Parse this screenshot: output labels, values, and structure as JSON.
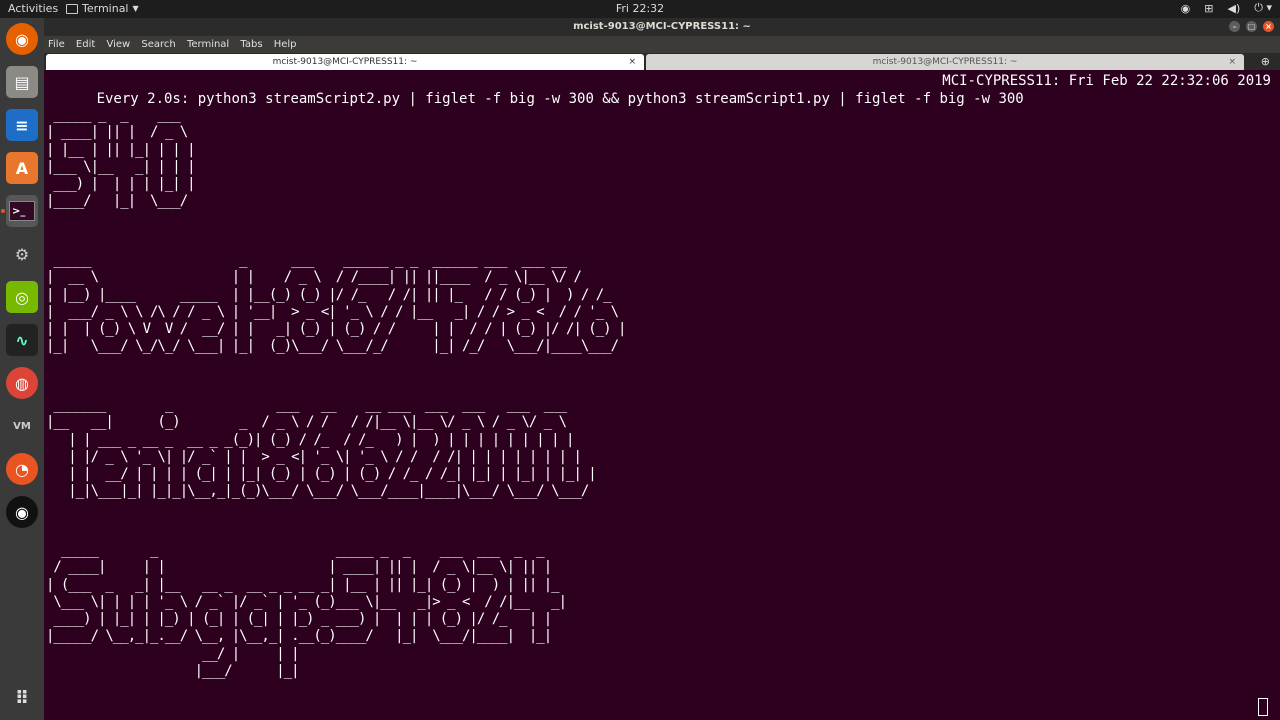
{
  "topbar": {
    "activities": "Activities",
    "app_name": "Terminal",
    "clock": "Fri 22:32"
  },
  "window": {
    "title": "mcist-9013@MCI-CYPRESS11: ~",
    "menu": [
      "File",
      "Edit",
      "View",
      "Search",
      "Terminal",
      "Tabs",
      "Help"
    ],
    "tabs": [
      {
        "label": "mcist-9013@MCI-CYPRESS11: ~",
        "active": true
      },
      {
        "label": "mcist-9013@MCI-CYPRESS11: ~",
        "active": false
      }
    ]
  },
  "terminal": {
    "watch_command": "Every 2.0s: python3 streamScript2.py | figlet -f big -w 300 && python3 streamScript1.py | figlet -f big -w 300",
    "watch_status": "MCI-CYPRESS11: Fri Feb 22 22:32:06 2019"
  },
  "dock": [
    "firefox-icon",
    "files-icon",
    "writer-icon",
    "software-center-icon",
    "terminal-icon",
    "settings-icon",
    "nvidia-icon",
    "system-monitor-icon",
    "chrome-icon",
    "vmware-icon",
    "ubuntu-icon",
    "obs-icon",
    "show-apps-icon"
  ],
  "colors": {
    "terminal_bg": "#2c001e",
    "accent": "#e95420",
    "dock_bg": "#3a3a3a"
  }
}
